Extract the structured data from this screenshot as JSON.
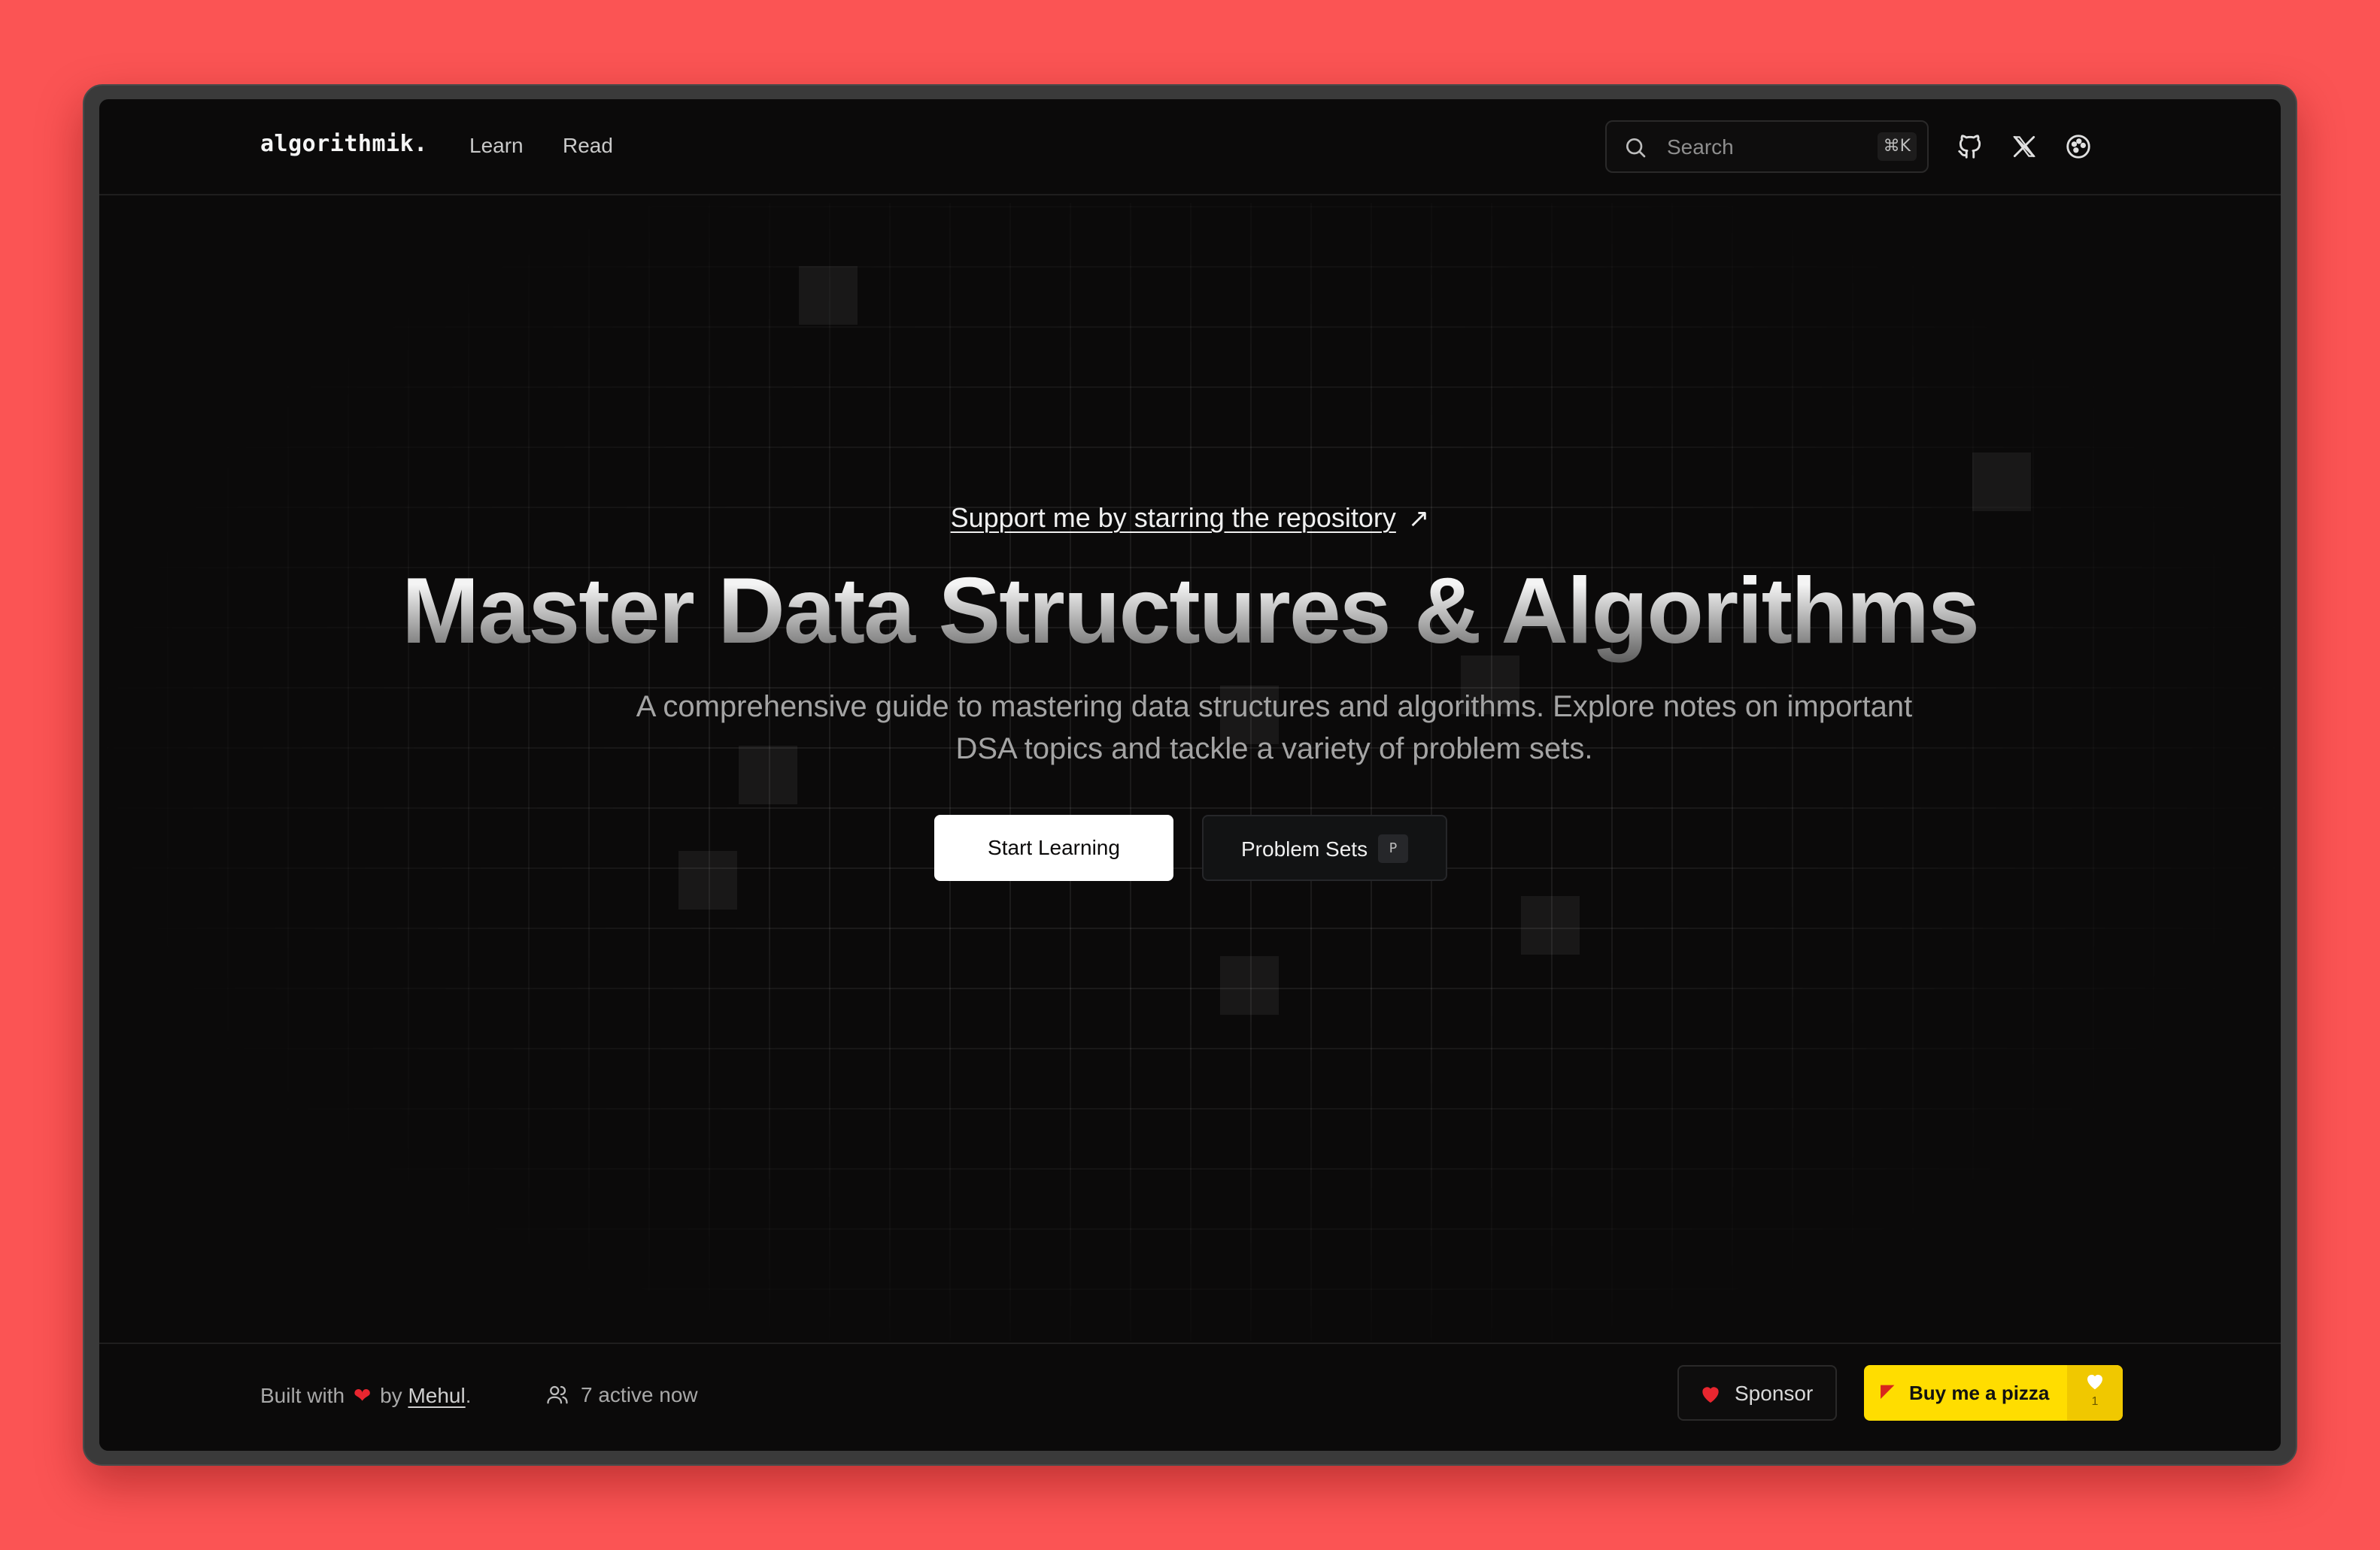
{
  "header": {
    "logo": "algorithmik.",
    "nav": [
      {
        "label": "Learn"
      },
      {
        "label": "Read"
      }
    ],
    "search": {
      "placeholder": "Search",
      "shortcut": "⌘K"
    },
    "icons": [
      "github-icon",
      "x-icon",
      "theme-icon"
    ]
  },
  "hero": {
    "support_link": "Support me by starring the repository",
    "support_arrow": "↗",
    "title": "Master Data Structures & Algorithms",
    "subtitle": "A comprehensive guide to mastering data structures and algorithms. Explore notes on important DSA topics and tackle a variety of problem sets.",
    "primary_button": "Start Learning",
    "secondary_button": "Problem Sets",
    "secondary_shortcut": "P"
  },
  "footer": {
    "built_prefix": "Built with",
    "built_by": "by",
    "author": "Mehul",
    "author_suffix": ".",
    "active_now": "7 active now",
    "sponsor": "Sponsor",
    "pizza": "Buy me a pizza",
    "pizza_count": "1"
  },
  "colors": {
    "page_background": "#fb5454",
    "screen_background": "#0b0a0a",
    "accent_yellow": "#ffdd00",
    "heart_red": "#e8262f"
  }
}
